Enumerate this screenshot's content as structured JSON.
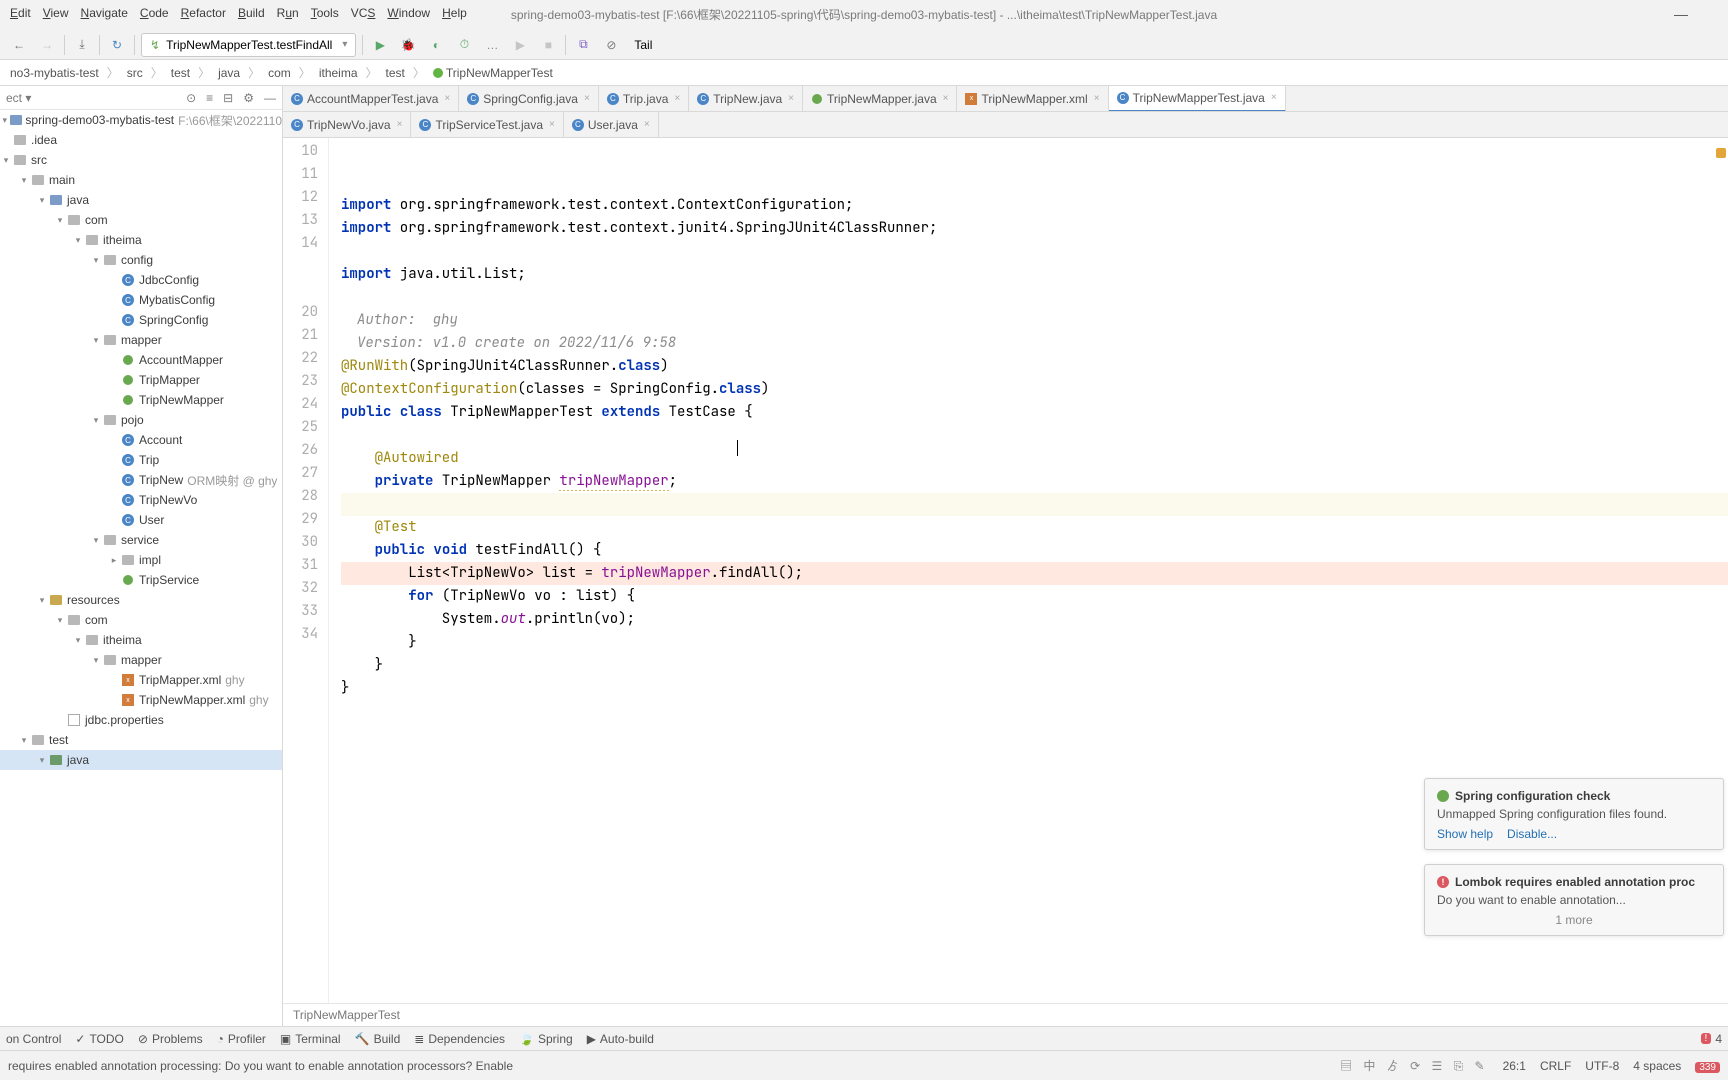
{
  "window": {
    "title": "spring-demo03-mybatis-test [F:\\66\\框架\\20221105-spring\\代码\\spring-demo03-mybatis-test] - ...\\itheima\\test\\TripNewMapperTest.java"
  },
  "menu": [
    "Edit",
    "View",
    "Navigate",
    "Code",
    "Refactor",
    "Build",
    "Run",
    "Tools",
    "VCS",
    "Window",
    "Help"
  ],
  "toolbar": {
    "run_config": "TripNewMapperTest.testFindAll",
    "tail_label": "Tail"
  },
  "breadcrumbs": [
    "no3-mybatis-test",
    "src",
    "test",
    "java",
    "com",
    "itheima",
    "test",
    "TripNewMapperTest"
  ],
  "project": {
    "root": "spring-demo03-mybatis-test",
    "root_path": "F:\\66\\框架\\2022110",
    "items": [
      {
        "name": ".idea"
      },
      {
        "name": "src",
        "children": [
          {
            "name": "main",
            "children": [
              {
                "name": "java",
                "children": [
                  {
                    "name": "com",
                    "children": [
                      {
                        "name": "itheima",
                        "children": [
                          {
                            "name": "config",
                            "children": [
                              {
                                "name": "JdbcConfig",
                                "kind": "class"
                              },
                              {
                                "name": "MybatisConfig",
                                "kind": "class"
                              },
                              {
                                "name": "SpringConfig",
                                "kind": "class"
                              }
                            ]
                          },
                          {
                            "name": "mapper",
                            "children": [
                              {
                                "name": "AccountMapper",
                                "kind": "bean"
                              },
                              {
                                "name": "TripMapper",
                                "kind": "bean"
                              },
                              {
                                "name": "TripNewMapper",
                                "kind": "bean"
                              }
                            ]
                          },
                          {
                            "name": "pojo",
                            "children": [
                              {
                                "name": "Account",
                                "kind": "class"
                              },
                              {
                                "name": "Trip",
                                "kind": "class"
                              },
                              {
                                "name": "TripNew",
                                "kind": "class",
                                "hint": "ORM映射  @ ghy"
                              },
                              {
                                "name": "TripNewVo",
                                "kind": "class"
                              },
                              {
                                "name": "User",
                                "kind": "class"
                              }
                            ]
                          },
                          {
                            "name": "service",
                            "children": [
                              {
                                "name": "impl"
                              },
                              {
                                "name": "TripService",
                                "kind": "bean"
                              }
                            ]
                          }
                        ]
                      }
                    ]
                  }
                ]
              },
              {
                "name": "resources",
                "children": [
                  {
                    "name": "com",
                    "children": [
                      {
                        "name": "itheima",
                        "children": [
                          {
                            "name": "mapper",
                            "children": [
                              {
                                "name": "TripMapper.xml",
                                "kind": "xml",
                                "hint": "ghy"
                              },
                              {
                                "name": "TripNewMapper.xml",
                                "kind": "xml",
                                "hint": "ghy"
                              }
                            ]
                          }
                        ]
                      }
                    ]
                  },
                  {
                    "name": "jdbc.properties",
                    "kind": "file"
                  }
                ]
              }
            ]
          },
          {
            "name": "test",
            "children": [
              {
                "name": "java",
                "selected": true
              }
            ]
          }
        ]
      }
    ]
  },
  "tabs_row1": [
    {
      "label": "AccountMapperTest.java",
      "kind": "class"
    },
    {
      "label": "SpringConfig.java",
      "kind": "class"
    },
    {
      "label": "Trip.java",
      "kind": "class"
    },
    {
      "label": "TripNew.java",
      "kind": "class"
    },
    {
      "label": "TripNewMapper.java",
      "kind": "bean"
    },
    {
      "label": "TripNewMapper.xml",
      "kind": "xml"
    },
    {
      "label": "TripNewMapperTest.java",
      "kind": "class",
      "active": true
    }
  ],
  "tabs_row2": [
    {
      "label": "TripNewVo.java",
      "kind": "class"
    },
    {
      "label": "TripServiceTest.java",
      "kind": "class"
    },
    {
      "label": "User.java",
      "kind": "class"
    }
  ],
  "code": {
    "gutter_start": 10,
    "lines": [
      {
        "n": 10,
        "html": "<span class='kw'>import</span> org.springframework.test.context.<span class='type'>ContextConfiguration</span>;",
        "cut": true
      },
      {
        "n": 11,
        "html": "<span class='kw'>import</span> org.springframework.test.context.junit4.SpringJUnit4ClassRunner;"
      },
      {
        "n": 12,
        "html": ""
      },
      {
        "n": 13,
        "html": "<span class='kw'>import</span> java.util.List;"
      },
      {
        "n": 14,
        "html": ""
      },
      {
        "n": 15,
        "hidden": true
      },
      {
        "n": 16,
        "doc": "Author:  ghy"
      },
      {
        "n": 17,
        "doc": "Version: v1.0 create on 2022/11/6 9:58"
      },
      {
        "n": 18,
        "hidden": true
      },
      {
        "n": 19,
        "hidden": true
      },
      {
        "n": 20,
        "html": "<span class='ann'>@RunWith</span>(SpringJUnit4ClassRunner.<span class='kw'>class</span>)",
        "run": true
      },
      {
        "n": 21,
        "html": "<span class='ann'>@ContextConfiguration</span>(classes = SpringConfig.<span class='kw'>class</span>)"
      },
      {
        "n": 22,
        "html": "<span class='kw'>public</span> <span class='kw'>class</span> TripNewMapperTest <span class='kw'>extends</span> TestCase {",
        "run": true
      },
      {
        "n": 23,
        "html": ""
      },
      {
        "n": 24,
        "html": "    <span class='ann'>@Autowired</span>"
      },
      {
        "n": 25,
        "html": "    <span class='kw'>private</span> TripNewMapper <span class='field err-under'>tripNewMapper</span>;",
        "bean": true
      },
      {
        "n": 26,
        "html": "",
        "caret": true
      },
      {
        "n": 27,
        "html": "    <span class='ann'>@Test</span>"
      },
      {
        "n": 28,
        "html": "    <span class='kw'>public</span> <span class='kw'>void</span> testFindAll() {",
        "run": true
      },
      {
        "n": 29,
        "html": "        List&lt;TripNewVo&gt; list = <span class='field'>tripNewMapper</span>.findAll();",
        "bp": true,
        "pink": true
      },
      {
        "n": 30,
        "html": "        <span class='kw'>for</span> (TripNewVo vo : list) {"
      },
      {
        "n": 31,
        "html": "            System.<span class='static'>out</span>.println(vo);"
      },
      {
        "n": 32,
        "html": "        }"
      },
      {
        "n": 33,
        "html": "    }"
      },
      {
        "n": 34,
        "html": "}"
      }
    ],
    "doc_author": "Author:  ghy",
    "doc_version": "Version: v1.0 create on 2022/11/6 9:58",
    "footer_crumb": "TripNewMapperTest"
  },
  "notifications": {
    "spring": {
      "title": "Spring configuration check",
      "body": "Unmapped Spring configuration files found.",
      "actions": [
        "Show help",
        "Disable..."
      ]
    },
    "lombok": {
      "title": "Lombok requires enabled annotation proc",
      "body": "Do you want to enable annotation...",
      "more": "1 more"
    }
  },
  "bottom_tools": [
    "on Control",
    "TODO",
    "Problems",
    "Profiler",
    "Terminal",
    "Build",
    "Dependencies",
    "Spring",
    "Auto-build"
  ],
  "bottom_badge": "4",
  "status": {
    "left": "requires enabled annotation processing: Do you want to enable annotation processors? Enable",
    "pos": "26:1",
    "eol": "CRLF",
    "enc": "UTF-8",
    "indent": "4 spaces",
    "badge": "339"
  }
}
